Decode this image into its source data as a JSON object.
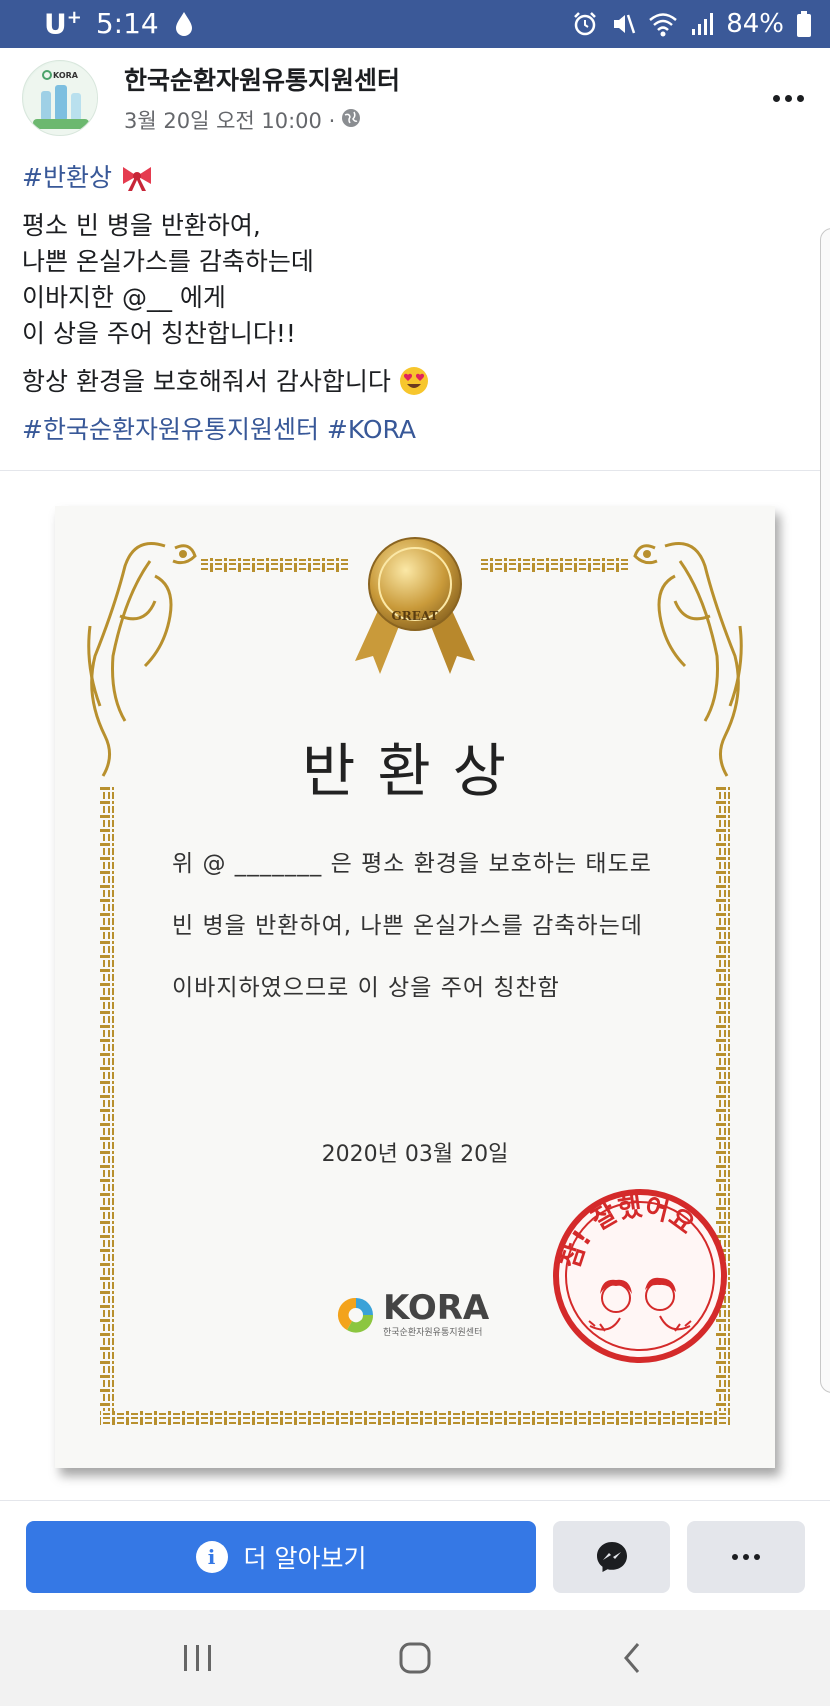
{
  "status_bar": {
    "carrier": "U",
    "carrier_sup": "+",
    "time": "5:14",
    "battery": "84%"
  },
  "post": {
    "page_name": "한국순환자원유통지원센터",
    "timestamp": "3월 20일 오전 10:00 ·",
    "hashtag_top": "#반환상",
    "lines": [
      "평소 빈 병을 반환하여,",
      "나쁜 온실가스를 감축하는데",
      "이바지한 @__ 에게",
      "이 상을 주어 칭찬합니다!!"
    ],
    "thanks": "항상 환경을 보호해줘서 감사합니다",
    "hashtags_bottom": "#한국순환자원유통지원센터 #KORA"
  },
  "certificate": {
    "medal_text": "GREAT",
    "title": "반환상",
    "line1": "위 @ _______ 은 평소 환경을 보호하는 태도로",
    "line2": "빈 병을 반환하여, 나쁜 온실가스를 감축하는데",
    "line3": "이바지하였으므로 이 상을 주어 칭찬함",
    "date": "2020년 03월 20일",
    "logo_text": "KORA",
    "logo_sub": "한국순환자원유통지원센터",
    "stamp_text": "참! 잘했어요"
  },
  "actions": {
    "learn_more_label": "더 알아보기"
  },
  "colors": {
    "facebook_blue": "#3b5998",
    "button_blue": "#3578e5",
    "gold": "#b8902e",
    "stamp_red": "#d42a2a"
  }
}
